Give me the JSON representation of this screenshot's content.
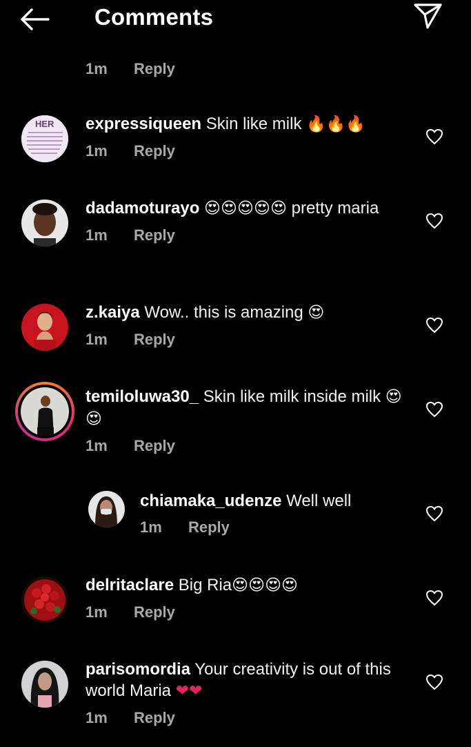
{
  "header": {
    "title": "Comments",
    "back_icon": "arrow-left-icon",
    "send_icon": "paper-plane-icon"
  },
  "orphan": {
    "time": "1m",
    "reply": "Reply"
  },
  "comments": [
    {
      "username": "expressiqueen",
      "text": "Skin like milk",
      "emoji": "🔥🔥🔥",
      "time": "1m",
      "reply": "Reply",
      "avatar_label": "HER"
    },
    {
      "username": "dadamoturayo",
      "text": "pretty maria",
      "emoji": "😍😍😍😍😍",
      "time": "1m",
      "reply": "Reply"
    },
    {
      "username": "z.kaiya",
      "text": "Wow.. this is amazing",
      "emoji": "😍",
      "time": "1m",
      "reply": "Reply"
    },
    {
      "username": "temiloluwa30_",
      "text": "Skin like milk inside milk",
      "emoji": "😍😍",
      "time": "1m",
      "reply": "Reply"
    },
    {
      "username": "chiamaka_udenze",
      "text": "Well well",
      "emoji": "",
      "time": "1m",
      "reply": "Reply"
    },
    {
      "username": "delritaclare",
      "text": "Big Ria",
      "emoji": "😍😍😍😍",
      "time": "1m",
      "reply": "Reply"
    },
    {
      "username": "parisomordia",
      "text": "Your creativity is out of this world Maria",
      "emoji": "❤❤",
      "time": "1m",
      "reply": "Reply"
    }
  ],
  "colors": {
    "background": "#000000",
    "text": "#f2f2f2",
    "muted": "#a8a8a8",
    "heart_emoji": "#e0245e"
  }
}
